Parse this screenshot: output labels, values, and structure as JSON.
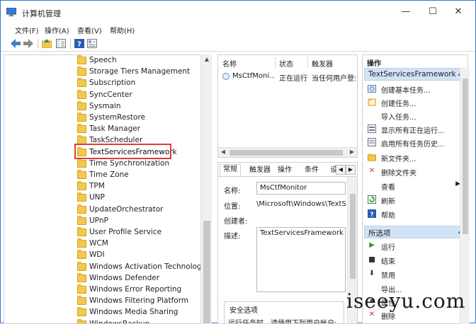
{
  "window": {
    "title": "计算机管理"
  },
  "caption": {
    "minimize": "—",
    "maximize": "☐",
    "close": "✕"
  },
  "menu": [
    "文件(F)",
    "操作(A)",
    "查看(V)",
    "帮助(H)"
  ],
  "tree": {
    "items": [
      "Speech",
      "Storage Tiers Management",
      "Subscription",
      "SyncCenter",
      "Sysmain",
      "SystemRestore",
      "Task Manager",
      "TaskScheduler",
      "TextServicesFramework",
      "Time Synchronization",
      "Time Zone",
      "TPM",
      "UNP",
      "UpdateOrchestrator",
      "UPnP",
      "User Profile Service",
      "WCM",
      "WDI",
      "Windows Activation Technologies",
      "Windows Defender",
      "Windows Error Reporting",
      "Windows Filtering Platform",
      "Windows Media Sharing",
      "WindowsBackup"
    ],
    "selected": "TextServicesFramework"
  },
  "list": {
    "columns": [
      "名称",
      "状态",
      "触发器"
    ],
    "rows": [
      {
        "name": "MsCtfMoni...",
        "status": "正在运行",
        "trigger": "当任何用户登录"
      }
    ]
  },
  "detail": {
    "tabs": [
      "常规",
      "触发器",
      "操作",
      "条件",
      "设"
    ],
    "fields": {
      "name_label": "名称:",
      "name_value": "MsCtfMonitor",
      "location_label": "位置:",
      "location_value": "\\Microsoft\\Windows\\TextS",
      "author_label": "创建者:",
      "author_value": "",
      "desc_label": "描述:",
      "desc_value": "TextServicesFramework m"
    },
    "security_title": "安全选项",
    "security_text": "运行任务时，请使用下列用户帐户:"
  },
  "actions": {
    "title": "操作",
    "section1": "TextServicesFramework",
    "items1": [
      {
        "label": "创建基本任务...",
        "icon": "basic-task-icon"
      },
      {
        "label": "创建任务...",
        "icon": "create-task-icon"
      },
      {
        "label": "导入任务...",
        "icon": ""
      },
      {
        "label": "显示所有正在运行...",
        "icon": "running-tasks-icon"
      },
      {
        "label": "启用所有任务历史...",
        "icon": "history-icon"
      },
      {
        "label": "新文件夹...",
        "icon": "new-folder-icon"
      },
      {
        "label": "删除文件夹",
        "icon": "delete-icon"
      },
      {
        "label": "查看",
        "icon": ""
      },
      {
        "label": "刷新",
        "icon": "refresh-icon"
      },
      {
        "label": "帮助",
        "icon": "help-icon"
      }
    ],
    "section2": "所选项",
    "items2": [
      {
        "label": "运行",
        "icon": "run-icon"
      },
      {
        "label": "结束",
        "icon": "end-icon"
      },
      {
        "label": "禁用",
        "icon": "disable-icon"
      },
      {
        "label": "导出...",
        "icon": ""
      },
      {
        "label": "属性",
        "icon": "properties-icon"
      },
      {
        "label": "删除",
        "icon": "delete-icon"
      }
    ]
  },
  "watermark": "iseeyu.com",
  "colors": {
    "accent": "#2b79d6",
    "section_bg": "#d3e3f6",
    "highlight_border": "#e03a3a",
    "folder": "#f2c94c"
  }
}
